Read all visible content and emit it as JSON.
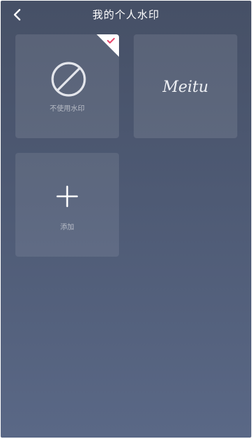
{
  "header": {
    "title": "我的个人水印",
    "back_icon": "chevron-left-icon"
  },
  "watermarks": {
    "none_label": "不使用水印",
    "none_icon": "prohibited-icon",
    "none_selected": true,
    "selected_icon": "checkmark-icon",
    "selected_accent": "#e8456b",
    "meitu_logo_text": "Meitu",
    "add_label": "添加",
    "add_icon": "plus-icon"
  },
  "colors": {
    "background_top": "#465066",
    "background_bottom": "#5a6886"
  }
}
